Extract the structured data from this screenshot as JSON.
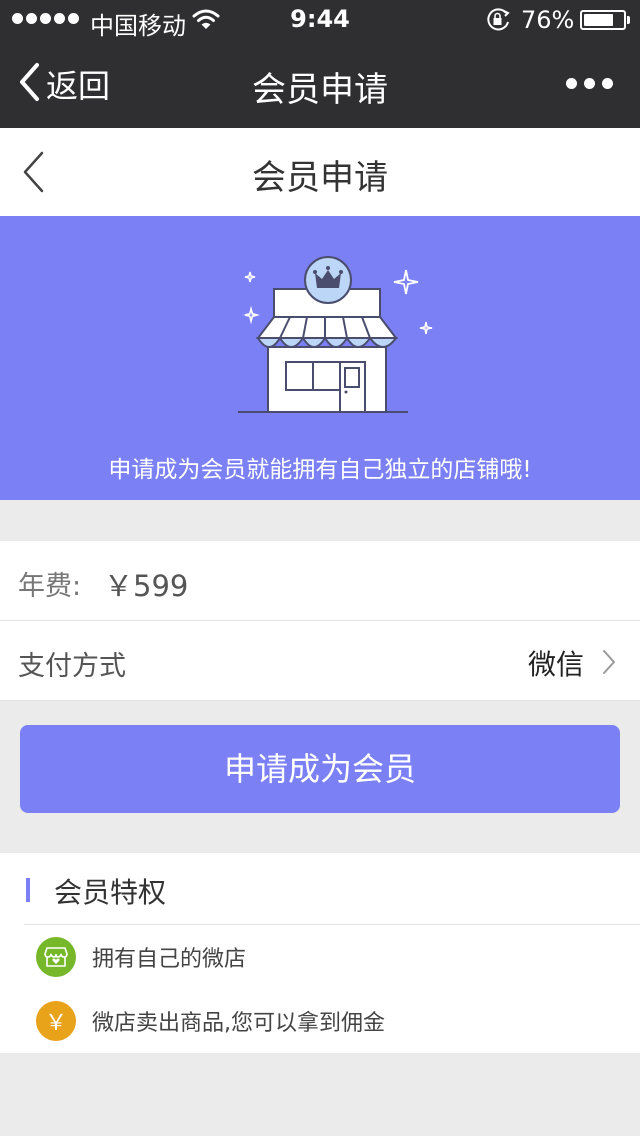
{
  "status_bar": {
    "carrier": "中国移动",
    "time": "9:44",
    "battery_text": "76%",
    "battery_level": 0.76
  },
  "nav": {
    "back_label": "返回",
    "title": "会员申请",
    "more_icon": "more-dots-icon"
  },
  "page_header": {
    "title": "会员申请",
    "back_icon": "chevron-left-icon"
  },
  "banner": {
    "text": "申请成为会员就能拥有自己独立的店铺哦!",
    "background_color": "#7b80f5",
    "illustration_icon": "shop-crown-icon"
  },
  "fee": {
    "label": "年费:",
    "value": "￥599"
  },
  "payment": {
    "label": "支付方式",
    "value": "微信",
    "chevron_icon": "chevron-right-icon"
  },
  "apply_button": {
    "label": "申请成为会员",
    "color": "#7b80f5"
  },
  "privileges": {
    "title": "会员特权",
    "items": [
      {
        "text": "拥有自己的微店",
        "icon": "shop-icon",
        "icon_color": "#76b82a"
      },
      {
        "text": "微店卖出商品,您可以拿到佣金",
        "icon": "yen-icon",
        "icon_glyph": "￥",
        "icon_color": "#e9a31b"
      }
    ]
  }
}
